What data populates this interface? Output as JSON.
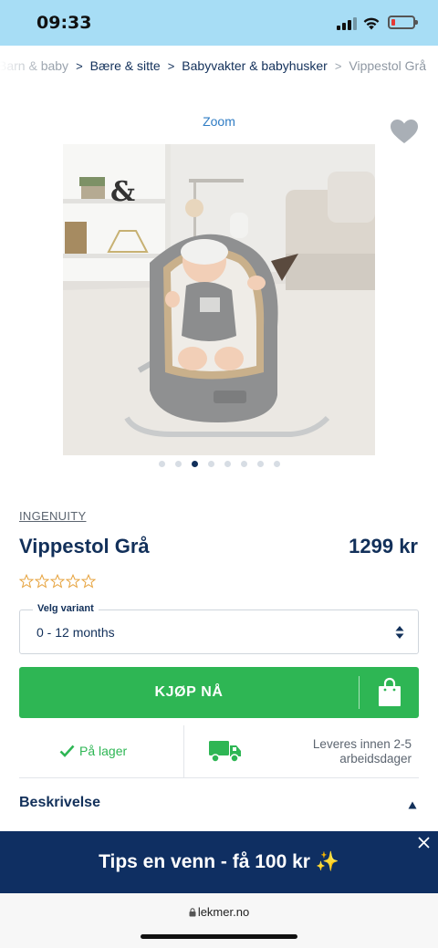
{
  "status_bar": {
    "time": "09:33",
    "battery_color": "#e53935"
  },
  "breadcrumb": {
    "items": [
      "Barn & baby",
      "Bære & sitte",
      "Babyvakter & babyhusker",
      "Vippestol Grå"
    ],
    "separator": ">"
  },
  "gallery": {
    "zoom_label": "Zoom",
    "dot_count": 8,
    "active_index": 2,
    "favorite_icon": "heart-icon"
  },
  "product": {
    "brand": "INGENUITY",
    "title": "Vippestol Grå",
    "price": "1299 kr",
    "rating": 0,
    "rating_max": 5
  },
  "variant": {
    "label": "Velg variant",
    "value": "0 - 12 months"
  },
  "buy": {
    "label": "KJØP NÅ",
    "color": "#2eb654"
  },
  "availability": {
    "stock_label": "På lager",
    "delivery_label": "Leveres innen 2-5 arbeidsdager"
  },
  "description": {
    "title": "Beskrivelse"
  },
  "banner": {
    "text": "Tips en venn - få 100 kr ✨",
    "color": "#0f2f62"
  },
  "browser": {
    "url": "lekmer.no"
  },
  "colors": {
    "navy": "#12305a",
    "link": "#2f7cc4",
    "status_bar": "#a7ddf5"
  }
}
